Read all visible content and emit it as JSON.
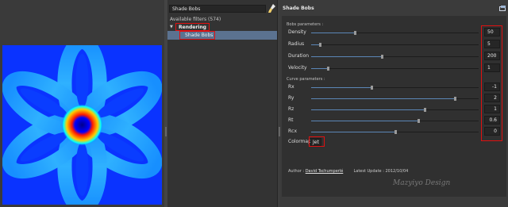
{
  "browser": {
    "search_value": "Shade Bobs",
    "filters_count": "Available filters (574)",
    "category": "Rendering",
    "selected_item": "Shade Bobs"
  },
  "panel": {
    "title": "Shade Bobs",
    "bobs_section": "Bobs parameters :",
    "curve_section": "Curve parameters :",
    "bobs_params": [
      {
        "label": "Density",
        "value": "50",
        "fraction": 0.26
      },
      {
        "label": "Radius",
        "value": "5",
        "fraction": 0.05
      },
      {
        "label": "Duration",
        "value": "200",
        "fraction": 0.42
      },
      {
        "label": "Velocity",
        "value": "1",
        "fraction": 0.1
      }
    ],
    "curve_params": [
      {
        "label": "Rx",
        "value": "-1",
        "fraction": 0.36
      },
      {
        "label": "Ry",
        "value": "2",
        "fraction": 0.86
      },
      {
        "label": "Rz",
        "value": "1",
        "fraction": 0.68
      },
      {
        "label": "Rt",
        "value": "0.6",
        "fraction": 0.64
      },
      {
        "label": "Rcx",
        "value": "0",
        "fraction": 0.5
      }
    ],
    "colormap_label": "Colormap",
    "colormap_value": "Jet",
    "author_prefix": "Author :",
    "author_name": "David Tschumperlé",
    "latest_update": "Latest Update : 2012/10/04"
  },
  "watermark": "Mazyiyo Design",
  "colors": {
    "selection": "#5b7290",
    "highlight_box": "#e01010",
    "slider_fill": "#5b86b7"
  }
}
